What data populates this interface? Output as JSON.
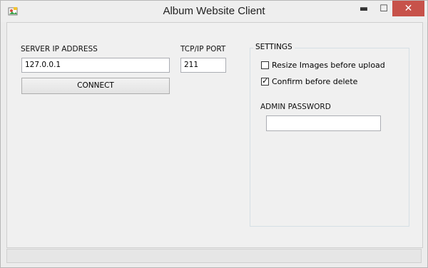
{
  "window": {
    "title": "Album Website Client",
    "minimize_glyph": "▬",
    "maximize_glyph": "☐",
    "close_glyph": "✕"
  },
  "connection": {
    "server_ip_label": "SERVER IP ADDRESS",
    "server_ip_value": "127.0.0.1",
    "port_label": "TCP/IP PORT",
    "port_value": "211",
    "connect_label": "CONNECT"
  },
  "settings": {
    "group_title": "SETTINGS",
    "resize_label": "Resize Images before upload",
    "resize_checked": false,
    "confirm_label": "Confirm before delete",
    "confirm_checked": true,
    "check_glyph": "✓",
    "admin_password_label": "ADMIN PASSWORD",
    "admin_password_value": ""
  },
  "colors": {
    "close_button": "#c7524a",
    "window_bg": "#f0f0f0"
  }
}
